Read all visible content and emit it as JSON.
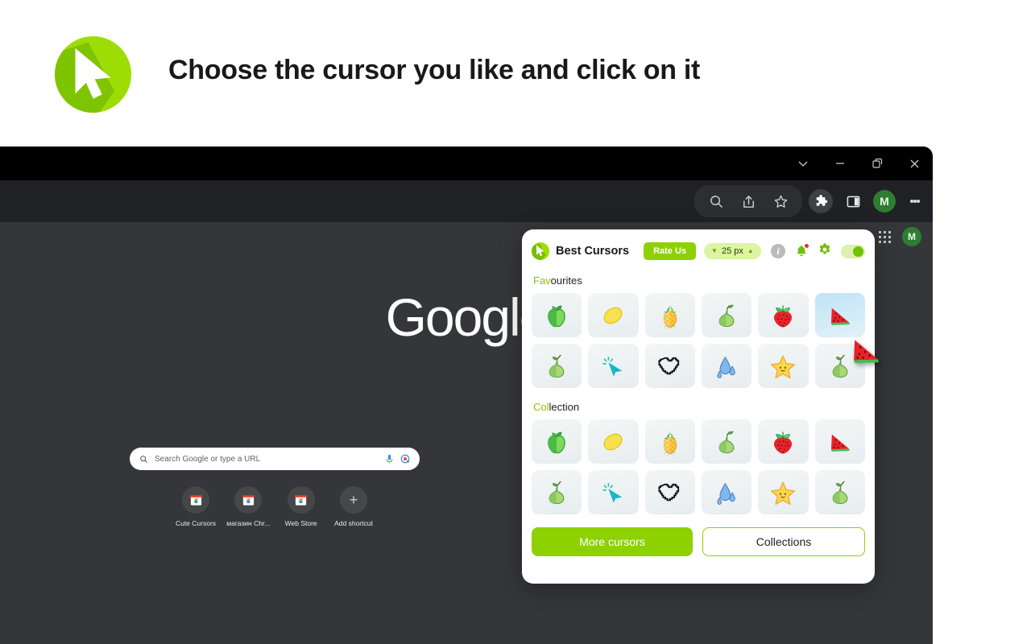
{
  "banner": {
    "logo_icon": "cursor-arrow-logo",
    "title": "Choose the cursor you like and click on it"
  },
  "browser": {
    "window_controls": [
      {
        "name": "chevron-down",
        "label": "⌄"
      },
      {
        "name": "minimize",
        "label": "—"
      },
      {
        "name": "restore",
        "label": "❐"
      },
      {
        "name": "close",
        "label": "✕"
      }
    ],
    "toolbar_icons": [
      "search-icon",
      "share-icon",
      "bookmark-star-icon",
      "extensions-puzzle-icon",
      "side-panel-icon"
    ],
    "profile_initial": "M",
    "menu_icon": "kebab-menu-icon"
  },
  "newtab": {
    "logo_text": "Google",
    "search_placeholder": "Search Google or type a URL",
    "mic_icon": "microphone-icon",
    "lens_icon": "google-lens-icon",
    "search_icon": "search-icon",
    "apps_icon": "apps-grid-icon",
    "profile_initial": "M",
    "shortcuts": [
      {
        "label": "Cute Cursors",
        "icon": "chrome-webstore-icon"
      },
      {
        "label": "магазин Chr...",
        "icon": "chrome-webstore-icon"
      },
      {
        "label": "Web Store",
        "icon": "chrome-webstore-icon"
      },
      {
        "label": "Add shortcut",
        "icon": "plus-icon"
      }
    ]
  },
  "popup": {
    "brand_name": "Best Cursors",
    "brand_logo_icon": "cursor-arrow-logo",
    "rate_button": "Rate Us",
    "size_badge": {
      "decrease_icon": "▼",
      "value": "25 px",
      "increase_icon": "▲"
    },
    "info_icon": "info-icon",
    "bell_icon": "notification-bell-icon",
    "gear_icon": "settings-gear-icon",
    "toggle_state": "on",
    "sections": [
      {
        "name": "favourites",
        "title_highlight": "Fav",
        "title_rest": "ourites",
        "items": [
          {
            "name": "green-apple",
            "icon": "apple-icon",
            "selected": false
          },
          {
            "name": "lemon",
            "icon": "lemon-icon",
            "selected": false
          },
          {
            "name": "pineapple",
            "icon": "pineapple-icon",
            "selected": false
          },
          {
            "name": "pear",
            "icon": "pear-icon",
            "selected": false
          },
          {
            "name": "strawberry",
            "icon": "strawberry-icon",
            "selected": false
          },
          {
            "name": "watermelon",
            "icon": "watermelon-icon",
            "selected": true
          },
          {
            "name": "pear-stem",
            "icon": "pear-icon",
            "selected": false
          },
          {
            "name": "teal-arrow",
            "icon": "cursor-arrow-icon",
            "selected": false
          },
          {
            "name": "pixel-heart",
            "icon": "pixel-heart-icon",
            "selected": false
          },
          {
            "name": "water-drops",
            "icon": "water-drop-icon",
            "selected": false
          },
          {
            "name": "star",
            "icon": "star-face-icon",
            "selected": false
          },
          {
            "name": "pear-2",
            "icon": "pear-icon",
            "selected": false
          }
        ]
      },
      {
        "name": "collection",
        "title_highlight": "Col",
        "title_rest": "lection",
        "items": [
          {
            "name": "green-apple",
            "icon": "apple-icon",
            "selected": false
          },
          {
            "name": "lemon",
            "icon": "lemon-icon",
            "selected": false
          },
          {
            "name": "pineapple",
            "icon": "pineapple-icon",
            "selected": false
          },
          {
            "name": "pear",
            "icon": "pear-icon",
            "selected": false
          },
          {
            "name": "strawberry",
            "icon": "strawberry-icon",
            "selected": false
          },
          {
            "name": "watermelon",
            "icon": "watermelon-icon",
            "selected": false
          },
          {
            "name": "pear-stem",
            "icon": "pear-icon",
            "selected": false
          },
          {
            "name": "teal-arrow",
            "icon": "cursor-arrow-icon",
            "selected": false
          },
          {
            "name": "pixel-heart",
            "icon": "pixel-heart-icon",
            "selected": false
          },
          {
            "name": "water-drops",
            "icon": "water-drop-icon",
            "selected": false
          },
          {
            "name": "star",
            "icon": "star-face-icon",
            "selected": false
          },
          {
            "name": "pear-2",
            "icon": "pear-icon",
            "selected": false
          }
        ]
      }
    ],
    "more_cursors_button": "More cursors",
    "collections_button": "Collections"
  },
  "colors": {
    "brand_green": "#8ed100",
    "logo_green": "#9ddd05",
    "badge_bg": "#dcf5a0",
    "selected_tile": "#bfe4f5",
    "titlebar": "#000000",
    "toolbar": "#202124",
    "page_bg": "#35363a",
    "avatar_green": "#2e7d32"
  },
  "cursor_overlay": {
    "icon": "watermelon-cursor"
  }
}
